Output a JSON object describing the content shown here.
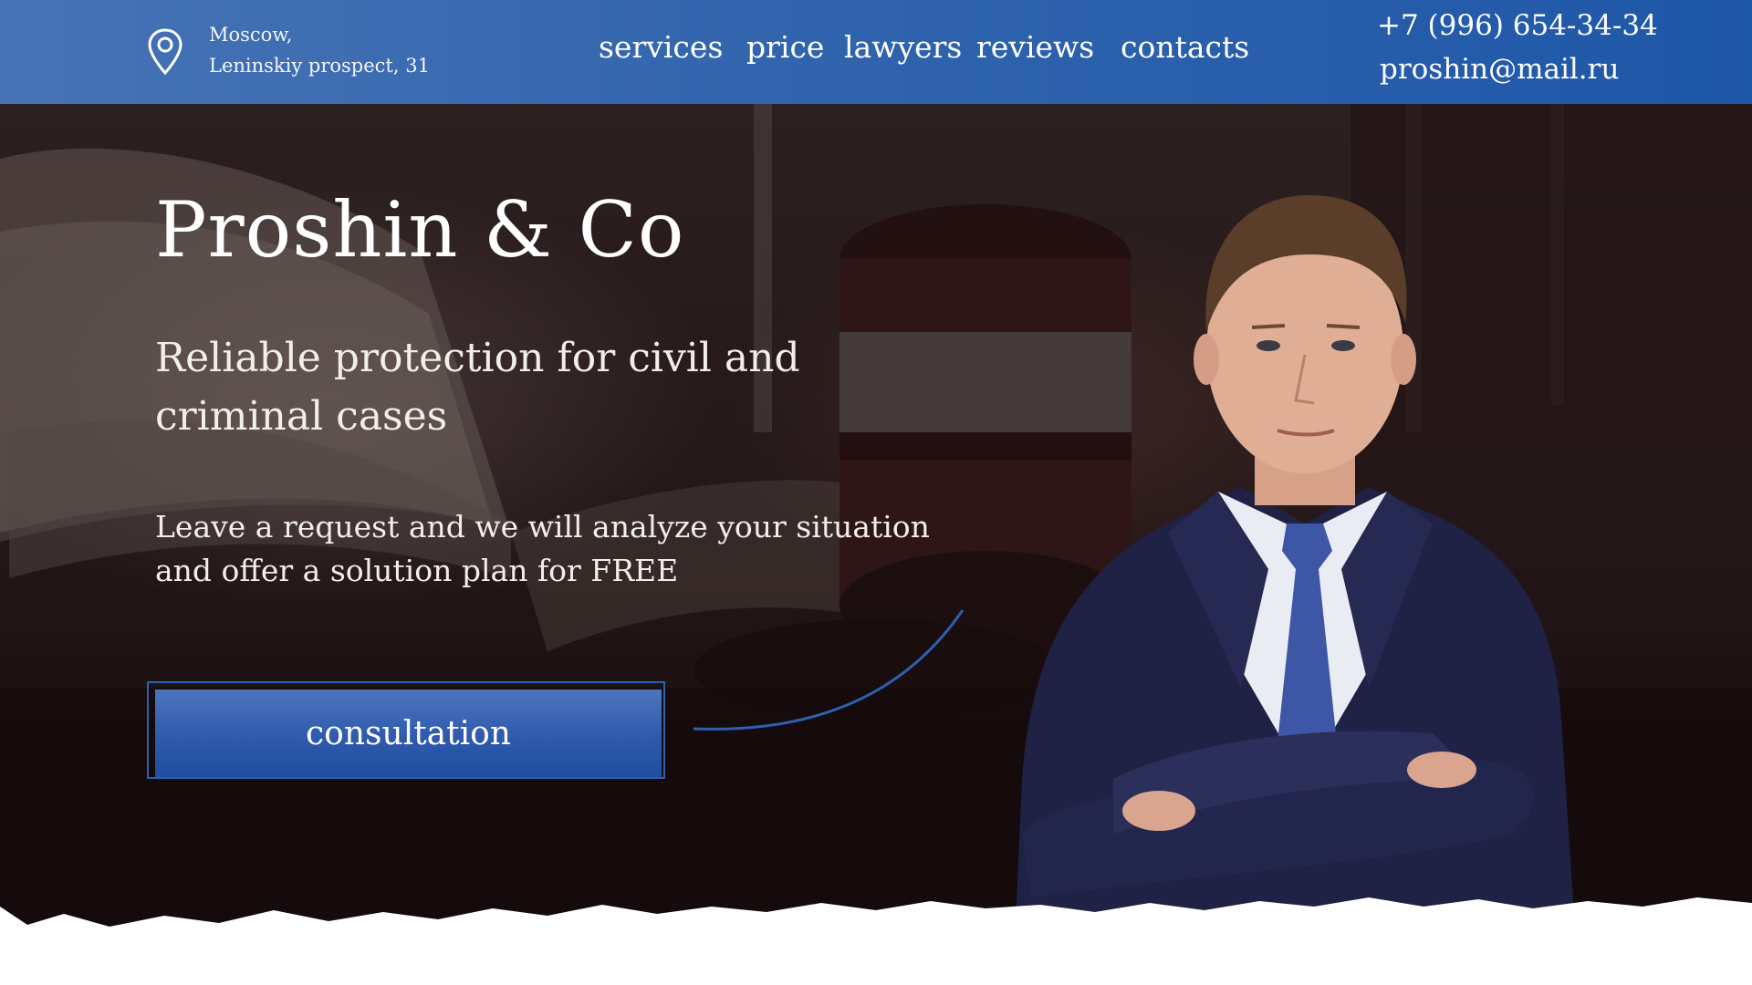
{
  "header": {
    "address_line1": "Moscow,",
    "address_line2": "Leninskiy prospect, 31",
    "nav": [
      "services",
      "price",
      "lawyers",
      "reviews",
      "contacts"
    ],
    "phone": "+7 (996) 654-34-34",
    "email": "proshin@mail.ru"
  },
  "hero": {
    "title": "Proshin & Co",
    "subtitle": "Reliable protection for civil and criminal cases",
    "text": "Leave a request and we will analyze your situation and offer a solution plan for FREE",
    "cta_label": "consultation"
  },
  "icons": {
    "location": "map-pin-icon"
  },
  "colors": {
    "header_blue": "#2f63ad",
    "button_blue": "#2f5aad",
    "hero_dark": "#2b1e1e"
  }
}
